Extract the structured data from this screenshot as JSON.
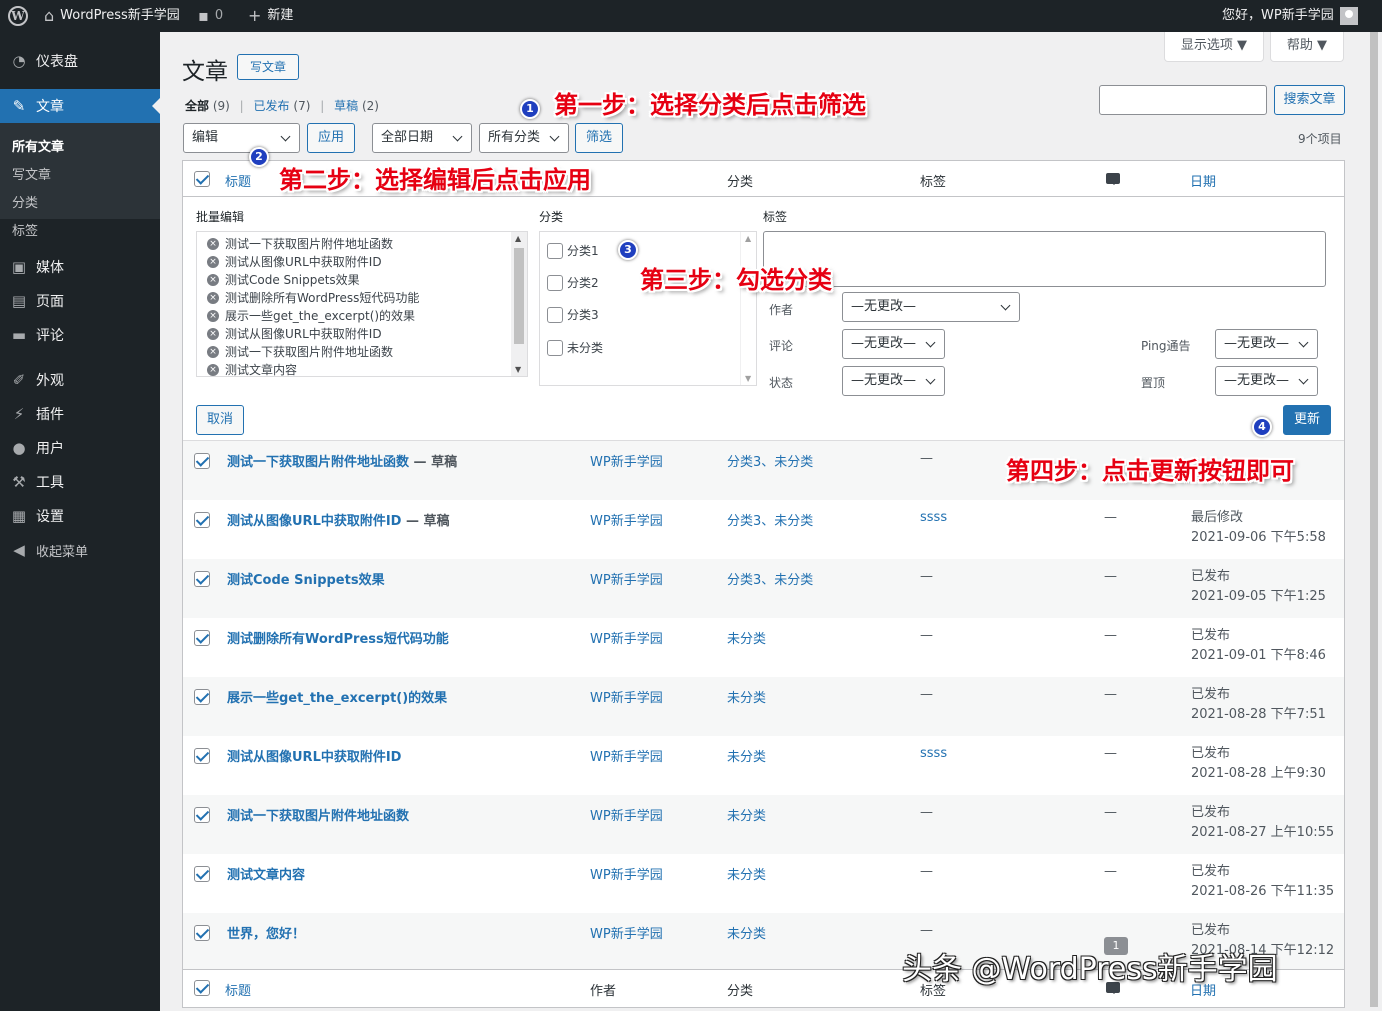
{
  "adminbar": {
    "site_name": "WordPress新手学园",
    "comments_count": "0",
    "new_label": "新建",
    "greeting": "您好，WP新手学园"
  },
  "sidebar": {
    "dashboard": "仪表盘",
    "posts": "文章",
    "submenu": [
      "所有文章",
      "写文章",
      "分类",
      "标签"
    ],
    "media": "媒体",
    "pages": "页面",
    "comments": "评论",
    "appearance": "外观",
    "plugins": "插件",
    "users": "用户",
    "tools": "工具",
    "settings": "设置",
    "collapse": "收起菜单"
  },
  "header": {
    "screen_options": "显示选项 ▼",
    "help": "帮助 ▼",
    "page_title": "文章",
    "add_new": "写文章",
    "search_button": "搜索文章",
    "search_value": ""
  },
  "filters": {
    "all": "全部",
    "all_count": "(9)",
    "published": "已发布",
    "published_count": "(7)",
    "drafts": "草稿",
    "drafts_count": "(2)",
    "sep": "|",
    "bulk_action": "编辑",
    "apply": "应用",
    "dates": "全部日期",
    "categories": "所有分类",
    "filter": "筛选",
    "items_count": "9个项目"
  },
  "table": {
    "col_title": "标题",
    "col_author": "作者",
    "col_categories": "分类",
    "col_tags": "标签",
    "col_date": "日期"
  },
  "bulk_edit": {
    "heading": "批量编辑",
    "categories_label": "分类",
    "tags_label": "标签",
    "posts": [
      "测试一下获取图片附件地址函数",
      "测试从图像URL中获取附件ID",
      "测试Code Snippets效果",
      "测试删除所有WordPress短代码功能",
      "展示一些get_the_excerpt()的效果",
      "测试从图像URL中获取附件ID",
      "测试一下获取图片附件地址函数",
      "测试文章内容"
    ],
    "cats": [
      "分类1",
      "分类2",
      "分类3",
      "未分类"
    ],
    "author_label": "作者",
    "author_value": "—无更改—",
    "comments_label": "评论",
    "comments_value": "—无更改—",
    "status_label": "状态",
    "status_value": "—无更改—",
    "ping_label": "Ping通告",
    "ping_value": "—无更改—",
    "sticky_label": "置顶",
    "sticky_value": "—无更改—",
    "cancel": "取消",
    "update": "更新",
    "remove_glyph": "×"
  },
  "rows": [
    {
      "title": "测试一下获取图片附件地址函数",
      "state": " — 草稿",
      "author": "WP新手学园",
      "cats": "分类3、未分类",
      "tags": "—",
      "comments": "",
      "date1": "",
      "date2": ""
    },
    {
      "title": "测试从图像URL中获取附件ID",
      "state": " — 草稿",
      "author": "WP新手学园",
      "cats": "分类3、未分类",
      "tags": "ssss",
      "comments": "—",
      "date1": "最后修改",
      "date2": "2021-09-06 下午5:58"
    },
    {
      "title": "测试Code Snippets效果",
      "state": "",
      "author": "WP新手学园",
      "cats": "分类3、未分类",
      "tags": "—",
      "comments": "—",
      "date1": "已发布",
      "date2": "2021-09-05 下午1:25"
    },
    {
      "title": "测试删除所有WordPress短代码功能",
      "state": "",
      "author": "WP新手学园",
      "cats": "未分类",
      "tags": "—",
      "comments": "—",
      "date1": "已发布",
      "date2": "2021-09-01 下午8:46"
    },
    {
      "title": "展示一些get_the_excerpt()的效果",
      "state": "",
      "author": "WP新手学园",
      "cats": "未分类",
      "tags": "—",
      "comments": "—",
      "date1": "已发布",
      "date2": "2021-08-28 下午7:51"
    },
    {
      "title": "测试从图像URL中获取附件ID",
      "state": "",
      "author": "WP新手学园",
      "cats": "未分类",
      "tags": "ssss",
      "comments": "—",
      "date1": "已发布",
      "date2": "2021-08-28 上午9:30"
    },
    {
      "title": "测试一下获取图片附件地址函数",
      "state": "",
      "author": "WP新手学园",
      "cats": "未分类",
      "tags": "—",
      "comments": "—",
      "date1": "已发布",
      "date2": "2021-08-27 上午10:55"
    },
    {
      "title": "测试文章内容",
      "state": "",
      "author": "WP新手学园",
      "cats": "未分类",
      "tags": "—",
      "comments": "—",
      "date1": "已发布",
      "date2": "2021-08-26 下午11:35"
    },
    {
      "title": "世界，您好！",
      "state": "",
      "author": "WP新手学园",
      "cats": "未分类",
      "tags": "—",
      "comments": "1",
      "date1": "已发布",
      "date2": "2021-08-14 下午12:12"
    }
  ],
  "annotations": {
    "step1": "第一步：选择分类后点击筛选",
    "step2": "第二步：选择编辑后点击应用",
    "step3": "第三步：勾选分类",
    "step4": "第四步：点击更新按钮即可",
    "n1": "1",
    "n2": "2",
    "n3": "3",
    "n4": "4",
    "watermark": "头条 @WordPress新手学园"
  },
  "colors": {
    "accent": "#2271b1",
    "sidebar": "#1d2327",
    "annotation": "#e60012"
  }
}
